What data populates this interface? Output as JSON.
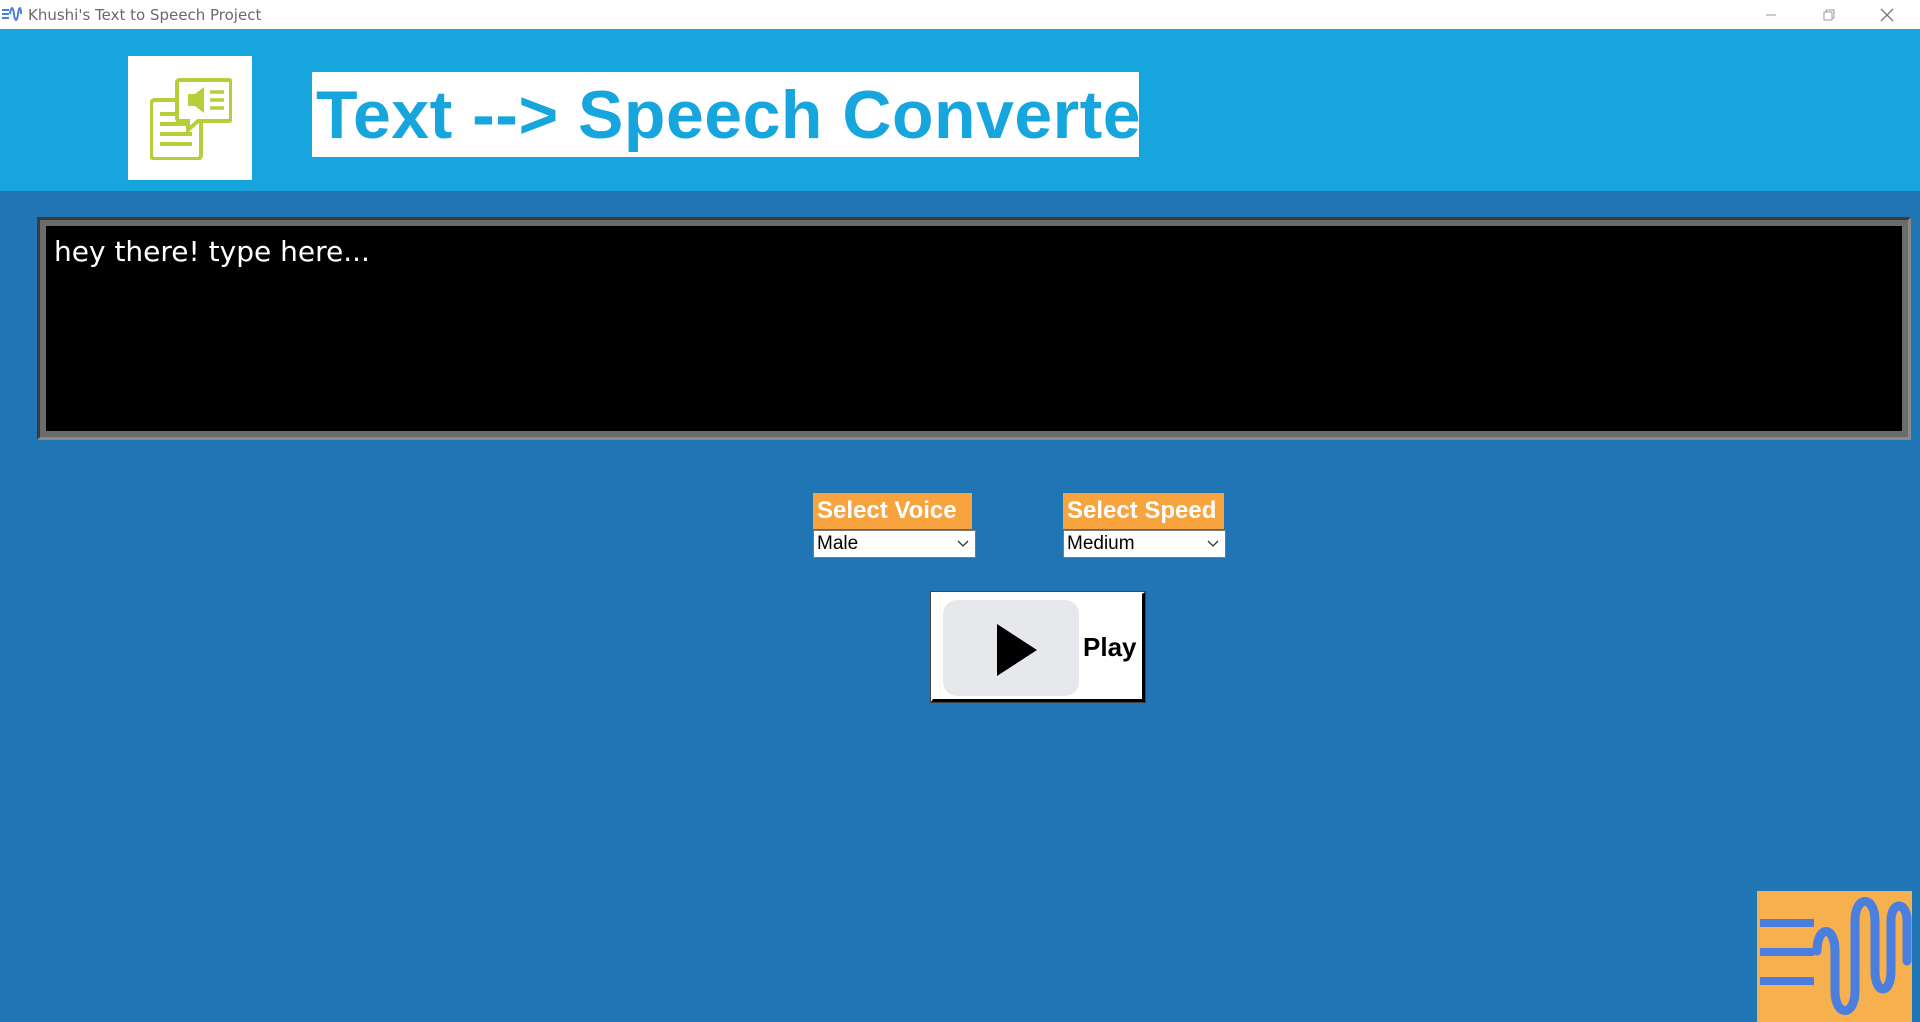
{
  "window": {
    "title": "Khushi's Text to Speech Project",
    "controls": [
      "minimize-icon",
      "restore-icon",
      "close-icon"
    ]
  },
  "header": {
    "logo_icon": "speech-document-icon",
    "title": "Text --> Speech Converter"
  },
  "text_area": {
    "value": "hey there! type here..."
  },
  "voice": {
    "label": "Select Voice",
    "selected": "Male"
  },
  "speed": {
    "label": "Select Speed",
    "selected": "Medium"
  },
  "play": {
    "label": "Play",
    "icon": "play-icon"
  },
  "colors": {
    "background": "#2076b4",
    "header": "#17a5de",
    "label_orange": "#f7a43f",
    "text_area_bg": "#000000",
    "logo_green": "#b5cf3a",
    "corner_logo_bg": "#f7b04e",
    "corner_logo_wave": "#4a7fe0"
  }
}
